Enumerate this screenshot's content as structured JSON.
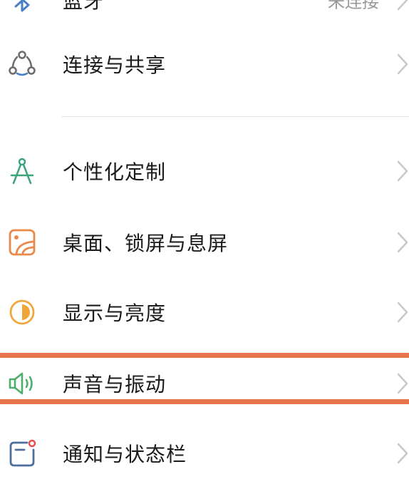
{
  "settings": {
    "items": [
      {
        "id": "bluetooth",
        "label": "蓝牙",
        "value": "未连接",
        "icon": "bluetooth-icon"
      },
      {
        "id": "connection-sharing",
        "label": "连接与共享",
        "icon": "share-icon"
      },
      {
        "id": "personalization",
        "label": "个性化定制",
        "icon": "compass-icon"
      },
      {
        "id": "desktop-lock-screen",
        "label": "桌面、锁屏与息屏",
        "icon": "wallpaper-icon"
      },
      {
        "id": "display-brightness",
        "label": "显示与亮度",
        "icon": "brightness-icon"
      },
      {
        "id": "sound-vibration",
        "label": "声音与振动",
        "icon": "speaker-icon"
      },
      {
        "id": "notification-statusbar",
        "label": "通知与状态栏",
        "icon": "notification-icon"
      }
    ]
  },
  "colors": {
    "highlight": "#e8744c",
    "chevron": "#c8c8c8",
    "icon_blue": "#4a7ec9",
    "icon_gray": "#6b6b6b",
    "icon_green": "#3aa57a",
    "icon_orange": "#e8884a",
    "icon_yellow": "#f0a63a",
    "icon_sound_green": "#4caf6a",
    "icon_notify_blue": "#4e6f9b",
    "notify_dot": "#e85050"
  }
}
